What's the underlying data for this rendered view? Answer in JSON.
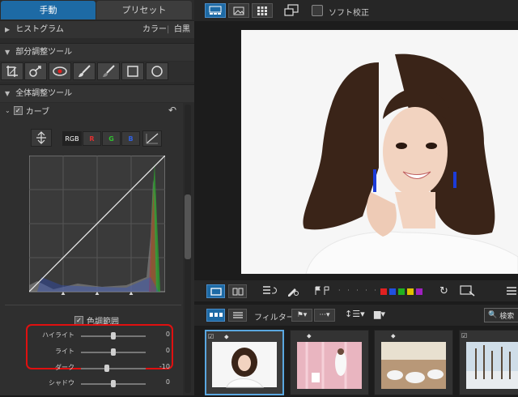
{
  "tabs": {
    "manual": "手動",
    "preset": "プリセット"
  },
  "histogram": {
    "title": "ヒストグラム",
    "color": "カラー",
    "divider": "|",
    "bw": "白黒"
  },
  "partial_tools": {
    "title": "部分調整ツール"
  },
  "global_tools": {
    "title": "全体調整ツール"
  },
  "curve": {
    "title": "カーブ",
    "channels": [
      "RGB",
      "R",
      "G",
      "B"
    ]
  },
  "tone_range": {
    "title": "色調範囲",
    "sliders": [
      {
        "label": "ハイライト",
        "value": "0",
        "level": 0
      },
      {
        "label": "ライト",
        "value": "0",
        "level": 0
      },
      {
        "label": "ダーク",
        "value": "-10",
        "level": -10
      },
      {
        "label": "シャドウ",
        "value": "0",
        "level": 0
      }
    ]
  },
  "toolbar": {
    "soft_proof": "ソフト校正"
  },
  "filter": {
    "label": "フィルター:",
    "search": "検索"
  },
  "label_colors": [
    "#e02020",
    "#2050e0",
    "#20b020",
    "#e0c000",
    "#a020c0"
  ],
  "colors": {
    "accent": "#1d6aa5",
    "highlight": "#e01010"
  }
}
